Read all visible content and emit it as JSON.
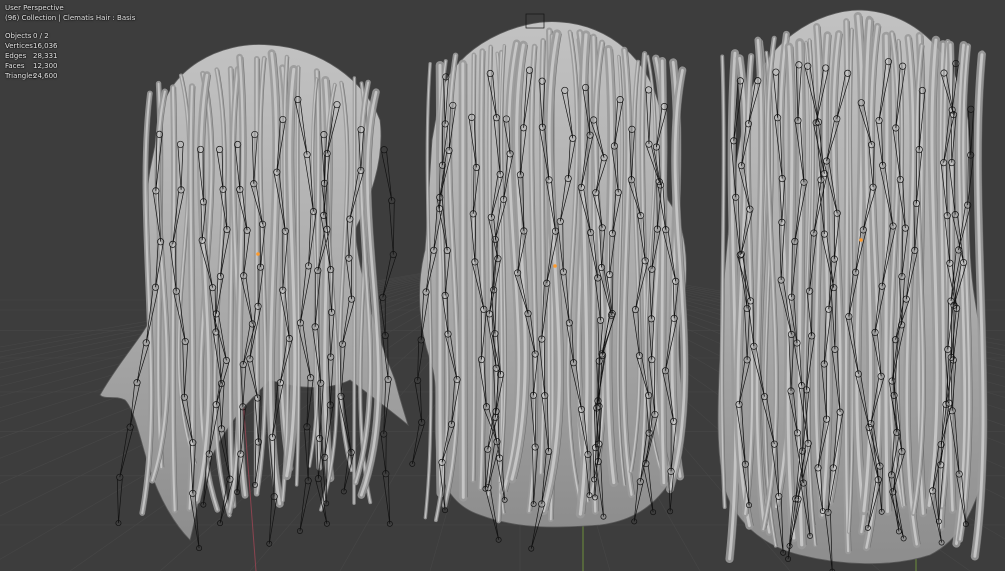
{
  "viewport": {
    "view_name": "User Perspective",
    "collection_info": "(96) Collection | Clematis Hair : Basis",
    "stats": [
      {
        "label": "Objects",
        "value": "0 / 2"
      },
      {
        "label": "Vertices",
        "value": "16,036"
      },
      {
        "label": "Edges",
        "value": "28,331"
      },
      {
        "label": "Faces",
        "value": "12,300"
      },
      {
        "label": "Triangles",
        "value": "24,600"
      }
    ]
  },
  "colors": {
    "background": "#3d3d3d",
    "grid_line": "#464646",
    "x_axis": "#9a4a55",
    "y_axis": "#6d8f3a",
    "hair_light": "#b4b4b4",
    "hair_dark": "#6e6e6e",
    "bone_line": "#111111",
    "origin": "#ff9a2a"
  },
  "scene_objects": [
    {
      "name": "hair-model-side-view"
    },
    {
      "name": "hair-model-back-three-quarter-view"
    },
    {
      "name": "hair-model-back-view"
    }
  ]
}
